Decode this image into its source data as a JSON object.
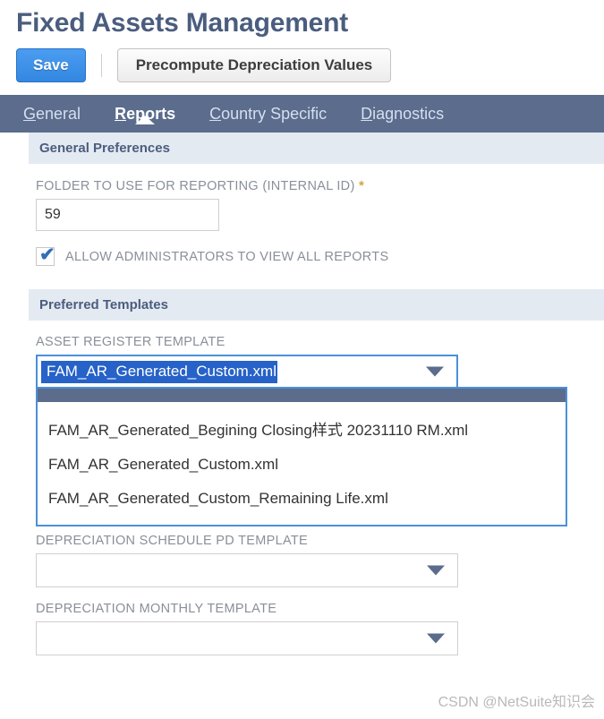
{
  "page": {
    "title": "Fixed Assets Management"
  },
  "toolbar": {
    "save_label": "Save",
    "precompute_label": "Precompute Depreciation Values"
  },
  "tabs": [
    {
      "accesskey": "G",
      "rest": "eneral",
      "label": "General",
      "active": false
    },
    {
      "accesskey": "R",
      "rest": "eports",
      "label": "Reports",
      "active": true
    },
    {
      "accesskey": "C",
      "rest": "ountry Specific",
      "label": "Country Specific",
      "active": false
    },
    {
      "accesskey": "D",
      "rest": "iagnostics",
      "label": "Diagnostics",
      "active": false
    }
  ],
  "sections": {
    "general_preferences": {
      "header": "General Preferences",
      "folder_field": {
        "label": "FOLDER TO USE FOR REPORTING (INTERNAL ID)",
        "required_marker": "*",
        "value": "59",
        "placeholder": ""
      },
      "allow_admins_checkbox": {
        "label": "ALLOW ADMINISTRATORS TO VIEW ALL REPORTS",
        "checked": true,
        "tick_glyph": "✔"
      }
    },
    "preferred_templates": {
      "header": "Preferred Templates",
      "asset_register_template": {
        "label": "ASSET REGISTER TEMPLATE",
        "selected_value": "FAM_AR_Generated_Custom.xml",
        "expanded": true,
        "options": [
          "FAM_AR_Generated_Begining Closing样式 20231110 RM.xml",
          "FAM_AR_Generated_Custom.xml",
          "FAM_AR_Generated_Custom_Remaining Life.xml"
        ]
      },
      "depreciation_schedule_pd_template": {
        "label": "DEPRECIATION SCHEDULE PD TEMPLATE",
        "selected_value": ""
      },
      "depreciation_monthly_template": {
        "label": "DEPRECIATION MONTHLY TEMPLATE",
        "selected_value": ""
      }
    }
  },
  "watermark": {
    "text": "CSDN @NetSuite知识会"
  },
  "colors": {
    "title": "#4a5d7e",
    "tabbar": "#5b6c8c",
    "save_button": "#3487e0",
    "section_header_bg": "#e4eaf2",
    "selection_blue": "#2662c8",
    "focus_border": "#4a90d9",
    "required_star": "#d2a24c"
  }
}
